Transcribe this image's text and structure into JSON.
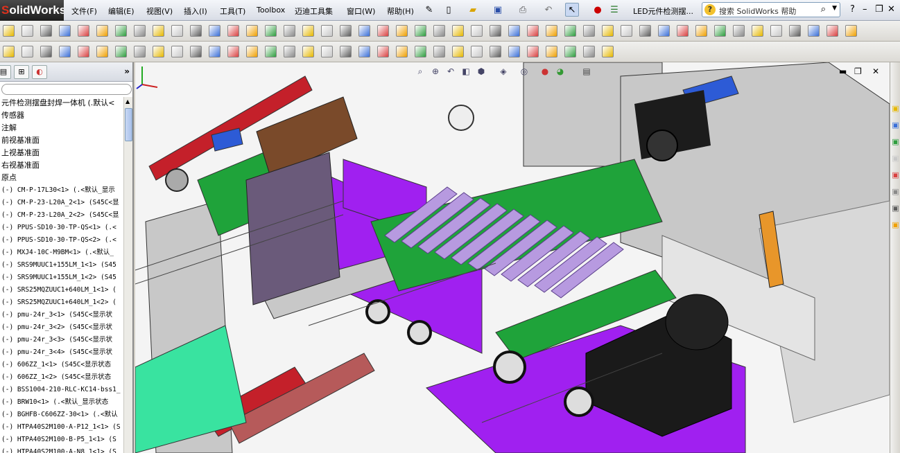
{
  "app": {
    "logo_prefix": "S",
    "logo_text": "olidWorks",
    "doc_title": "LED元件检测摆..."
  },
  "menu": [
    {
      "label": "文件(F)"
    },
    {
      "label": "编辑(E)"
    },
    {
      "label": "视图(V)"
    },
    {
      "label": "插入(I)"
    },
    {
      "label": "工具(T)"
    },
    {
      "label": "Toolbox"
    },
    {
      "label": "迈迪工具集"
    },
    {
      "label": "窗口(W)"
    },
    {
      "label": "帮助(H)"
    }
  ],
  "search": {
    "placeholder": "搜索 SolidWorks 帮助"
  },
  "tree": {
    "items": [
      {
        "label": "元件检测摆盘封焊一体机  (.默认<"
      },
      {
        "label": "传感器"
      },
      {
        "label": "注解"
      },
      {
        "label": "前视基准面"
      },
      {
        "label": "上视基准面"
      },
      {
        "label": "右视基准面"
      },
      {
        "label": "原点"
      },
      {
        "label": "(-) CM-P-17L30<1> (.<默认_显示"
      },
      {
        "label": "(-) CM-P-23-L20A_2<1> (S45C<显"
      },
      {
        "label": "(-) CM-P-23-L20A_2<2> (S45C<显"
      },
      {
        "label": "(-) PPUS-SD10-30-TP-QS<1> (.<"
      },
      {
        "label": "(-) PPUS-SD10-30-TP-QS<2> (.<"
      },
      {
        "label": "(-) MXJ4-10C-M9BM<1> (.<默认_"
      },
      {
        "label": "(-) SRS9MUUC1+155LM_1<1> (S45"
      },
      {
        "label": "(-) SRS9MUUC1+155LM_1<2> (S45"
      },
      {
        "label": "(-) SRS25MQZUUC1+640LM_1<1> ("
      },
      {
        "label": "(-) SRS25MQZUUC1+640LM_1<2> ("
      },
      {
        "label": "(-) pmu-24r_3<1> (S45C<显示状"
      },
      {
        "label": "(-) pmu-24r_3<2> (S45C<显示状"
      },
      {
        "label": "(-) pmu-24r_3<3> (S45C<显示状"
      },
      {
        "label": "(-) pmu-24r_3<4> (S45C<显示状"
      },
      {
        "label": "(-) 606ZZ_1<1> (S45C<显示状态"
      },
      {
        "label": "(-) 606ZZ_1<2> (S45C<显示状态"
      },
      {
        "label": "(-) BSS1004-210-RLC-KC14-bss1_"
      },
      {
        "label": "(-) BRW10<1> (.<默认_显示状态"
      },
      {
        "label": "(-) BGHFB-C606ZZ-30<1> (.<默认"
      },
      {
        "label": "(-) HTPA40S2M100-A-P12_1<1> (S"
      },
      {
        "label": "(-) HTPA40S2M100-B-P5_1<1> (S"
      },
      {
        "label": "(-) HTPA40S2M100-A-N8_1<1> (S"
      }
    ]
  },
  "colors": {
    "purple_machine": "#a020f0",
    "lavender_tubes": "#b79ae0",
    "green_plate": "#1fa33a",
    "red_belt": "#c4202a",
    "blue_part": "#2d5bd6",
    "gray_frame": "#c8c8c8",
    "mint_plate": "#39e3a0"
  },
  "icons": [
    "new-icon",
    "open-icon",
    "save-icon",
    "print-icon",
    "undo-icon",
    "select-icon",
    "rebuild-icon",
    "options-icon",
    "search-icon",
    "help-icon",
    "triad-icon"
  ]
}
